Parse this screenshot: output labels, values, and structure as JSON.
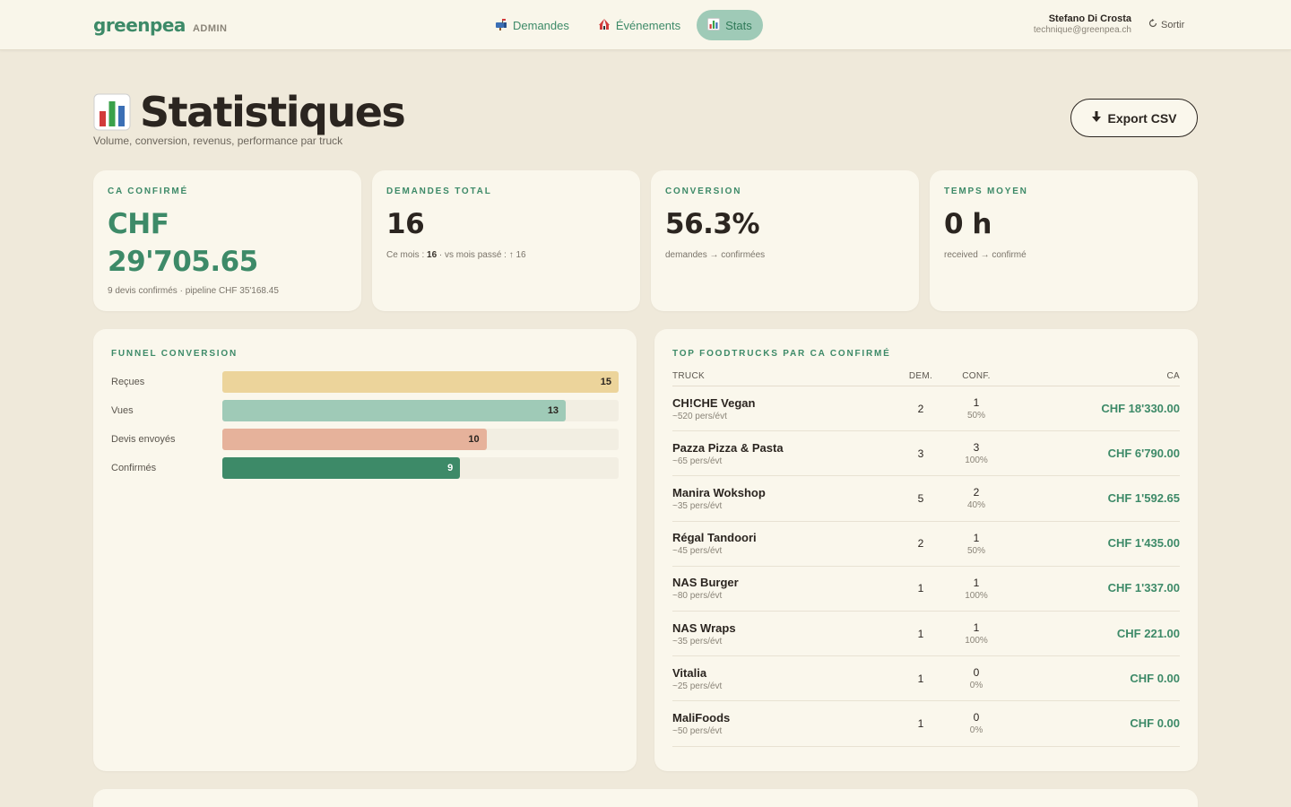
{
  "brand": {
    "name": "greenpea",
    "tag": "ADMIN"
  },
  "nav": [
    {
      "label": "Demandes",
      "icon": "mailbox-icon",
      "active": false
    },
    {
      "label": "Événements",
      "icon": "circus-tent-icon",
      "active": false
    },
    {
      "label": "Stats",
      "icon": "bar-chart-icon",
      "active": true
    }
  ],
  "user": {
    "name": "Stefano Di Crosta",
    "email": "technique@greenpea.ch",
    "logout": "Sortir"
  },
  "header": {
    "title": "Statistiques",
    "subtitle": "Volume, conversion, revenus, performance par truck",
    "export_label": "Export CSV"
  },
  "kpis": {
    "revenue": {
      "label": "CA CONFIRMÉ",
      "line1": "CHF",
      "line2": "29'705.65",
      "note": "9 devis confirmés · pipeline CHF 35'168.45"
    },
    "requests": {
      "label": "DEMANDES TOTAL",
      "value": "16",
      "note_prefix": "Ce mois : ",
      "note_month": "16",
      "note_suffix": " · vs mois passé : ↑ 16"
    },
    "conversion": {
      "label": "CONVERSION",
      "value": "56.3%",
      "note": "demandes → confirmées"
    },
    "avg_time": {
      "label": "TEMPS MOYEN",
      "value": "0 h",
      "note": "received → confirmé"
    }
  },
  "funnel": {
    "title": "FUNNEL CONVERSION",
    "max": 15,
    "steps": [
      {
        "label": "Reçues",
        "value": 15,
        "color": "#ecd49b"
      },
      {
        "label": "Vues",
        "value": 13,
        "color": "#9fcab7"
      },
      {
        "label": "Devis envoyés",
        "value": 10,
        "color": "#e6b29b"
      },
      {
        "label": "Confirmés",
        "value": 9,
        "color": "#3d8a68"
      }
    ]
  },
  "trucks": {
    "title": "TOP FOODTRUCKS PAR CA CONFIRMÉ",
    "columns": {
      "truck": "TRUCK",
      "dem": "DEM.",
      "conf": "CONF.",
      "ca": "CA"
    },
    "rows": [
      {
        "name": "CH!CHE Vegan",
        "capacity": "~520 pers/évt",
        "dem": "2",
        "conf": "1",
        "rate": "50%",
        "ca": "CHF 18'330.00"
      },
      {
        "name": "Pazza Pizza & Pasta",
        "capacity": "~65 pers/évt",
        "dem": "3",
        "conf": "3",
        "rate": "100%",
        "ca": "CHF 6'790.00"
      },
      {
        "name": "Manira Wokshop",
        "capacity": "~35 pers/évt",
        "dem": "5",
        "conf": "2",
        "rate": "40%",
        "ca": "CHF 1'592.65"
      },
      {
        "name": "Régal Tandoori",
        "capacity": "~45 pers/évt",
        "dem": "2",
        "conf": "1",
        "rate": "50%",
        "ca": "CHF 1'435.00"
      },
      {
        "name": "NAS Burger",
        "capacity": "~80 pers/évt",
        "dem": "1",
        "conf": "1",
        "rate": "100%",
        "ca": "CHF 1'337.00"
      },
      {
        "name": "NAS Wraps",
        "capacity": "~35 pers/évt",
        "dem": "1",
        "conf": "1",
        "rate": "100%",
        "ca": "CHF 221.00"
      },
      {
        "name": "Vitalia",
        "capacity": "~25 pers/évt",
        "dem": "1",
        "conf": "0",
        "rate": "0%",
        "ca": "CHF 0.00"
      },
      {
        "name": "MaliFoods",
        "capacity": "~50 pers/évt",
        "dem": "1",
        "conf": "0",
        "rate": "0%",
        "ca": "CHF 0.00"
      }
    ]
  }
}
